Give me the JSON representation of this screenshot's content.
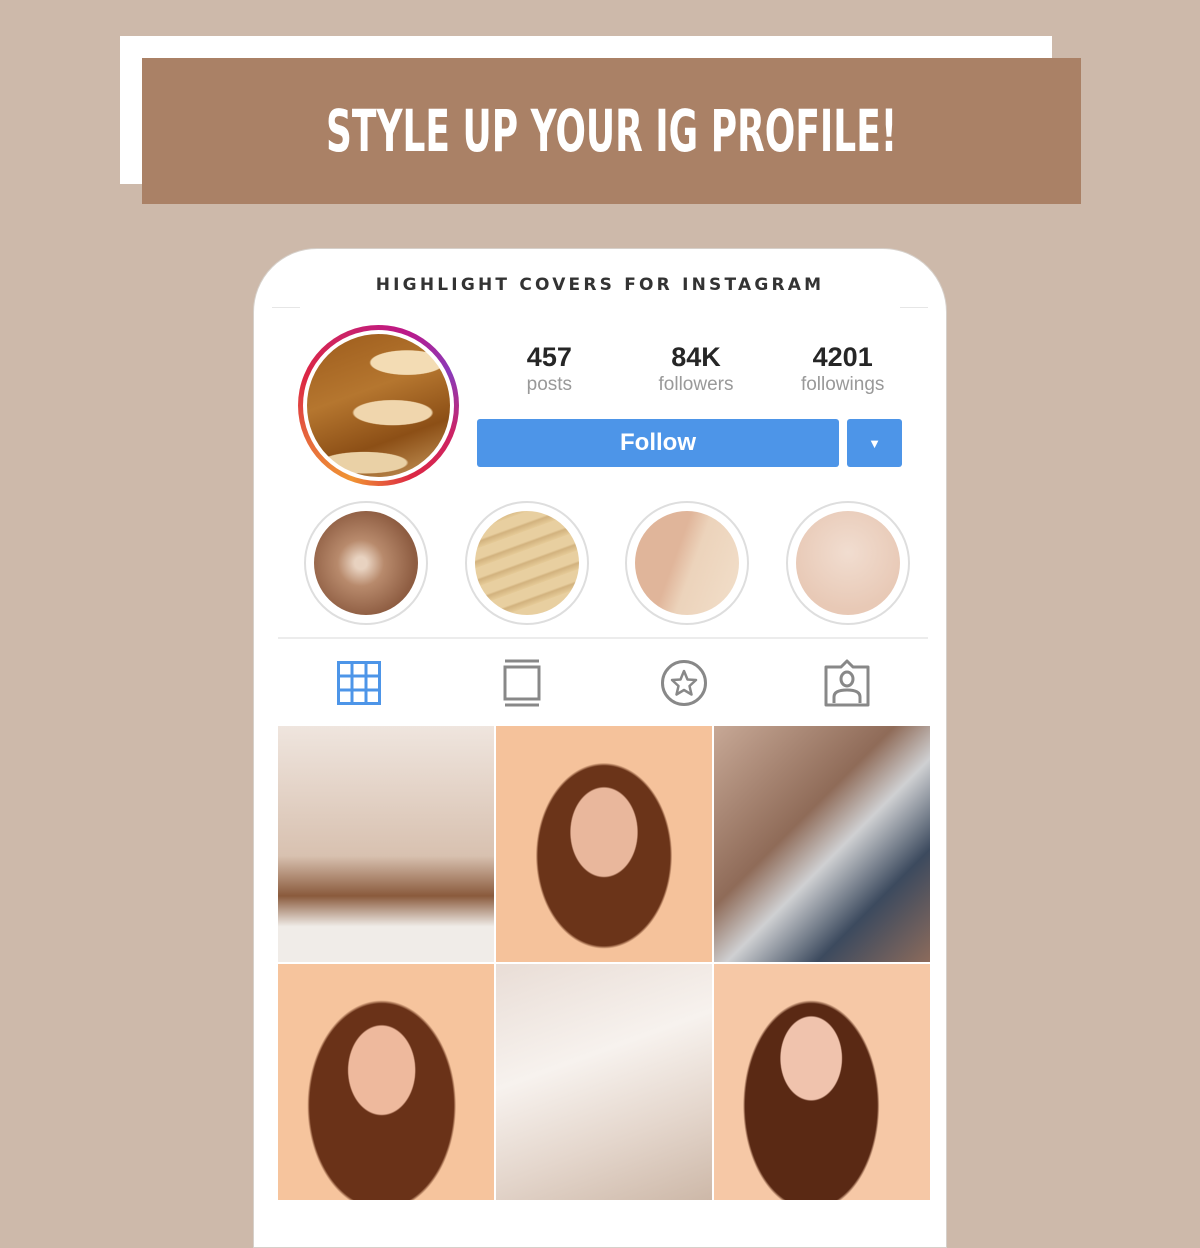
{
  "banner": {
    "title": "STYLE UP YOUR IG PROFILE!"
  },
  "phone": {
    "header": "HIGHLIGHT COVERS FOR INSTAGRAM",
    "profile": {
      "avatar": "profile-picture",
      "stats": [
        {
          "value": "457",
          "label": "posts"
        },
        {
          "value": "84K",
          "label": "followers"
        },
        {
          "value": "4201",
          "label": "followings"
        }
      ],
      "follow_label": "Follow",
      "dropdown_icon": "caret-down-icon"
    },
    "highlights": [
      "fern",
      "sand",
      "blush-marble",
      "pink-texture"
    ],
    "tabs": [
      {
        "name": "grid",
        "icon": "grid-icon",
        "active": true
      },
      {
        "name": "feed",
        "icon": "feed-icon",
        "active": false
      },
      {
        "name": "saved",
        "icon": "star-icon",
        "active": false
      },
      {
        "name": "tagged",
        "icon": "tagged-user-icon",
        "active": false
      }
    ],
    "colors": {
      "accent": "#4d95e8",
      "inactive_icon": "#888888",
      "banner": "#aa8166",
      "background": "#cdb9aa"
    },
    "posts": [
      "cozy-bedroom-tray",
      "woman-surprised-1",
      "laptop-typing",
      "woman-surprised-2",
      "book-and-cookies",
      "woman-lipstick"
    ]
  }
}
